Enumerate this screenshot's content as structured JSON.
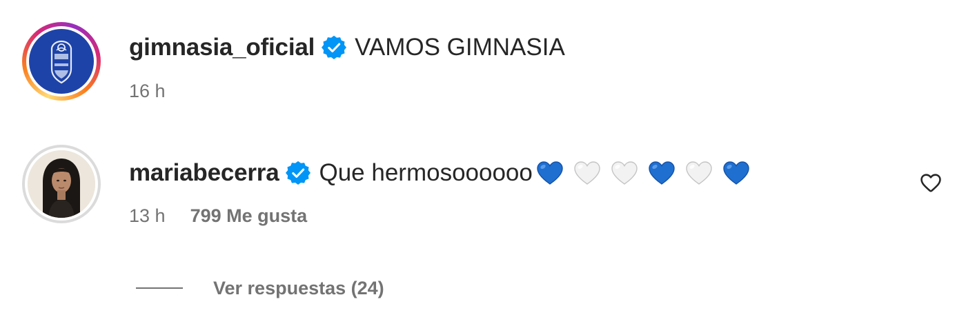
{
  "caption": {
    "username": "gimnasia_oficial",
    "text": "VAMOS GIMNASIA",
    "time": "16 h",
    "avatar_icon": "club-crest-icon",
    "verified_icon": "verified-badge-icon"
  },
  "comment": {
    "username": "mariabecerra",
    "text": "Que hermosoooooo",
    "hearts": [
      "blue",
      "white",
      "white",
      "blue",
      "white",
      "blue"
    ],
    "time": "13 h",
    "likes": "799 Me gusta",
    "avatar_icon": "profile-photo",
    "like_icon": "heart-outline-icon"
  },
  "replies": {
    "label": "Ver respuestas (24)"
  },
  "colors": {
    "text": "#262626",
    "secondary": "#737373",
    "verified": "#0095f6",
    "heart_blue": "#1f6fd0",
    "heart_white": "#f2f2f2",
    "club_blue": "#1e43a8"
  }
}
